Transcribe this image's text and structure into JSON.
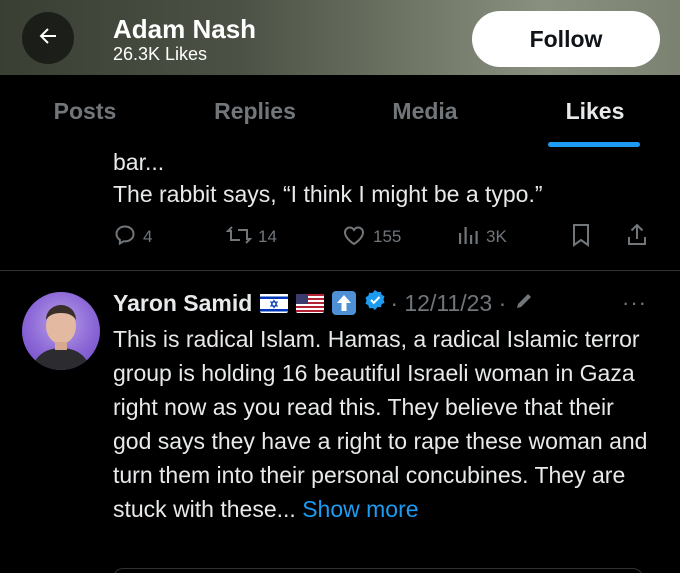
{
  "header": {
    "title": "Adam Nash",
    "subtitle": "26.3K Likes",
    "follow_label": "Follow",
    "back_icon": "arrow-left-icon",
    "background_color": "#5d6356"
  },
  "tabs": [
    {
      "label": "Posts",
      "active": false
    },
    {
      "label": "Replies",
      "active": false
    },
    {
      "label": "Media",
      "active": false
    },
    {
      "label": "Likes",
      "active": true
    }
  ],
  "previous_post": {
    "text_lines": [
      "bar...",
      "The rabbit says, “I think I might be a typo.”"
    ],
    "reply_count": "4",
    "repost_count": "14",
    "like_count": "155",
    "view_count": "3K"
  },
  "post": {
    "author": "Yaron Samid",
    "badges": [
      "israel-flag-icon",
      "us-flag-icon",
      "up-arrow-emoji-icon"
    ],
    "verified": true,
    "date": "· 12/11/23 ·",
    "text": "This is radical Islam. Hamas, a radical Islamic terror group is holding 16 beautiful Israeli woman in Gaza right now as you read this. They believe that their god says they have a right to rape these woman and turn them into their personal concubines. They are stuck with these...",
    "show_more": "Show more",
    "more_icon": "···"
  },
  "colors": {
    "accent": "#1d9bf0",
    "muted": "#71767b",
    "text": "#e7e9ea",
    "background": "#000000"
  }
}
